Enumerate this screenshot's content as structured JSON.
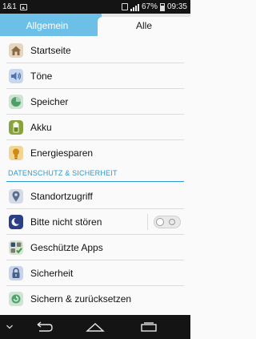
{
  "status_bar": {
    "carrier": "1&1",
    "battery": "67%",
    "time": "09:35"
  },
  "tabs": [
    {
      "label": "Allgemein",
      "selected": false
    },
    {
      "label": "Alle",
      "selected": true
    }
  ],
  "items_top": [
    {
      "label": "Startseite",
      "icon": "home-icon"
    },
    {
      "label": "Töne",
      "icon": "speaker-icon"
    },
    {
      "label": "Speicher",
      "icon": "storage-pie-icon"
    },
    {
      "label": "Akku",
      "icon": "battery-icon"
    },
    {
      "label": "Energiesparen",
      "icon": "lightbulb-icon"
    }
  ],
  "section_privacy": {
    "title": "DATENSCHUTZ & SICHERHEIT",
    "items": [
      {
        "label": "Standortzugriff",
        "icon": "location-pin-icon"
      },
      {
        "label": "Bitte nicht stören",
        "icon": "moon-icon",
        "toggle": false
      },
      {
        "label": "Geschützte Apps",
        "icon": "protected-apps-icon"
      },
      {
        "label": "Sicherheit",
        "icon": "lock-icon"
      },
      {
        "label": "Sichern & zurücksetzen",
        "icon": "backup-icon"
      }
    ]
  },
  "colors": {
    "accent": "#2c99d3",
    "tab_active_bg": "#6cc0e7",
    "status_bg": "#141414"
  }
}
